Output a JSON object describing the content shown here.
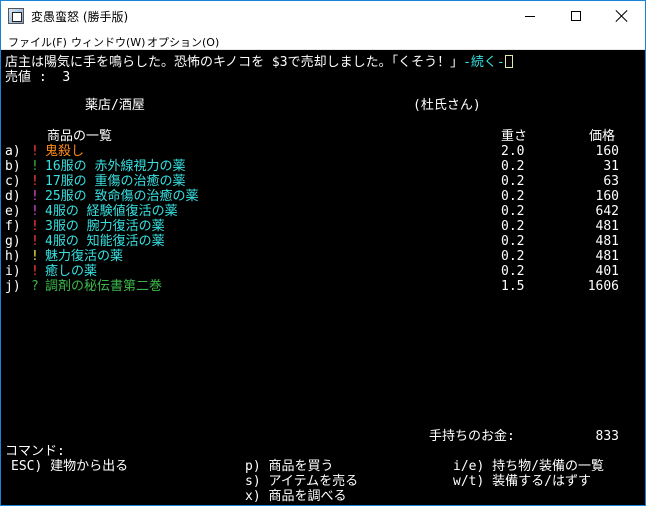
{
  "window": {
    "title": "変愚蛮怒 (勝手版)",
    "menu": [
      "ファイル(F)",
      "ウィンドウ(W)",
      "オプション(O)"
    ]
  },
  "message": {
    "text": "店主は陽気に手を鳴らした。恐怖のキノコを $3で売却しました。「くそう！」",
    "more": "-続く-"
  },
  "sale": {
    "label": "売値 :",
    "value": "3"
  },
  "shop": {
    "name": "薬店/酒屋",
    "owner": "(杜氏さん)"
  },
  "list_header": {
    "items": "商品の一覧",
    "weight": "重さ",
    "price": "価格"
  },
  "items": [
    {
      "key": "a)",
      "symbol": "!",
      "name": "鬼殺し",
      "weight": "2.0",
      "price": "160"
    },
    {
      "key": "b)",
      "symbol": "!",
      "name": "16服の 赤外線視力の薬",
      "weight": "0.2",
      "price": "31"
    },
    {
      "key": "c)",
      "symbol": "!",
      "name": "17服の 重傷の治癒の薬",
      "weight": "0.2",
      "price": "63"
    },
    {
      "key": "d)",
      "symbol": "!",
      "name": "25服の 致命傷の治癒の薬",
      "weight": "0.2",
      "price": "160"
    },
    {
      "key": "e)",
      "symbol": "!",
      "name": "4服の 経験値復活の薬",
      "weight": "0.2",
      "price": "642"
    },
    {
      "key": "f)",
      "symbol": "!",
      "name": "3服の 腕力復活の薬",
      "weight": "0.2",
      "price": "481"
    },
    {
      "key": "g)",
      "symbol": "!",
      "name": "4服の 知能復活の薬",
      "weight": "0.2",
      "price": "481"
    },
    {
      "key": "h)",
      "symbol": "!",
      "name": "魅力復活の薬",
      "weight": "0.2",
      "price": "481"
    },
    {
      "key": "i)",
      "symbol": "!",
      "name": "癒しの薬",
      "weight": "0.2",
      "price": "401"
    },
    {
      "key": "j)",
      "symbol": "?",
      "name": "調剤の秘伝書第二巻",
      "weight": "1.5",
      "price": "1606"
    }
  ],
  "gold": {
    "label": "手持ちのお金:",
    "value": "833"
  },
  "commands": {
    "label": "コマンド:",
    "exit": "ESC) 建物から出る",
    "purchase": "p) 商品を買う",
    "sell": "s) アイテムを売る",
    "examine": "x) 商品を調べる",
    "inventory": "i/e) 持ち物/装備の一覧",
    "wear": "w/t) 装備する/はずす"
  },
  "colors": {
    "background": "#000000",
    "text": "#ffffff",
    "red": "#ff3c3c",
    "orange": "#ff8a1a",
    "cyan": "#38e0e0",
    "violet": "#d24ad2",
    "yellow": "#f0f040",
    "green": "#3cb64a"
  }
}
